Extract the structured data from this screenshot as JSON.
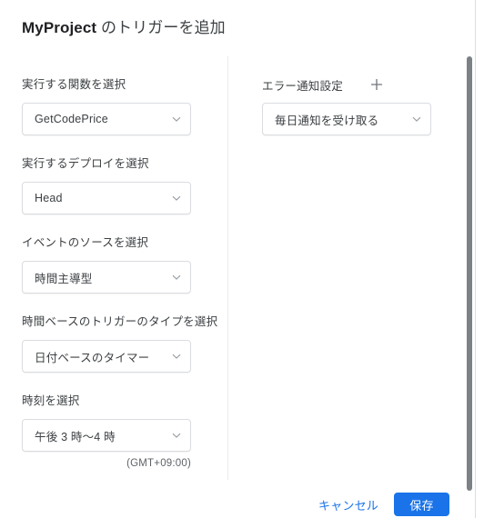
{
  "dialog": {
    "title_project": "MyProject",
    "title_rest": " のトリガーを追加"
  },
  "left_column": {
    "fields": [
      {
        "label": "実行する関数を選択",
        "value": "GetCodePrice"
      },
      {
        "label": "実行するデプロイを選択",
        "value": "Head"
      },
      {
        "label": "イベントのソースを選択",
        "value": "時間主導型"
      },
      {
        "label": "時間ベースのトリガーのタイプを選択",
        "value": "日付ベースのタイマー"
      },
      {
        "label": "時刻を選択",
        "value": "午後 3 時〜4 時"
      }
    ],
    "timezone_note": "(GMT+09:00)"
  },
  "right_column": {
    "header_label": "エラー通知設定",
    "add_icon": "plus-icon",
    "notification": {
      "value": "毎日通知を受け取る"
    }
  },
  "footer": {
    "cancel_label": "キャンセル",
    "save_label": "保存"
  },
  "icons": {
    "caret": "chevron-down-icon"
  },
  "colors": {
    "accent": "#1a73e8",
    "text": "#3c4043",
    "border": "#dadce0",
    "divider": "#e8eaed",
    "scrollbar": "#7c8185"
  }
}
